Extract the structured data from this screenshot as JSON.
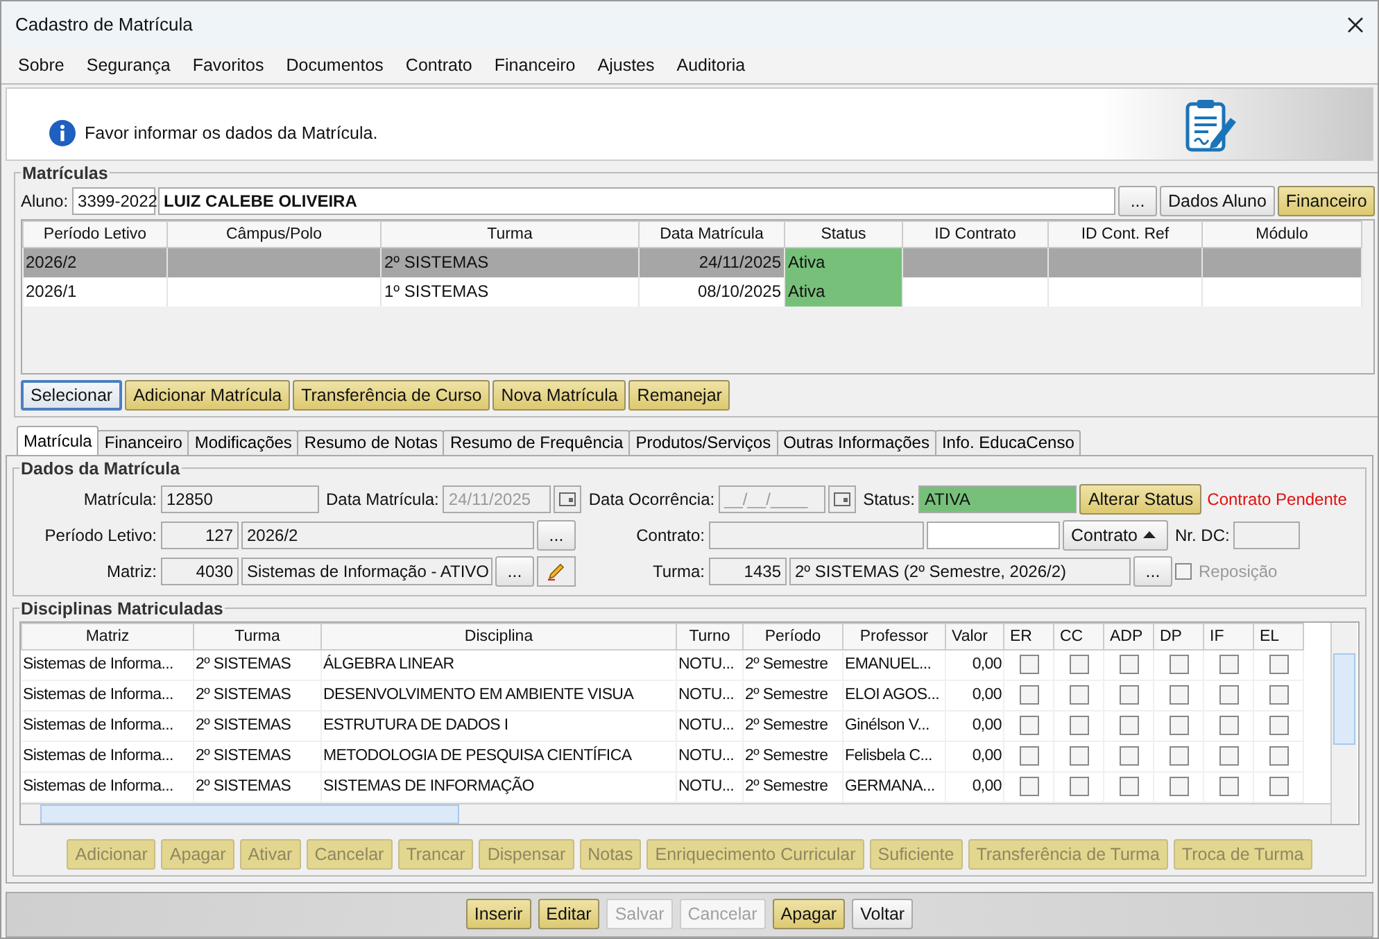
{
  "window": {
    "title": "Cadastro de Matrícula"
  },
  "menu": [
    "Sobre",
    "Segurança",
    "Favoritos",
    "Documentos",
    "Contrato",
    "Financeiro",
    "Ajustes",
    "Auditoria"
  ],
  "banner": {
    "message": "Favor informar os dados da Matrícula."
  },
  "matriculas": {
    "legend": "Matrículas",
    "aluno_label": "Aluno:",
    "aluno_code": "3399-2022",
    "aluno_name": "LUIZ CALEBE OLIVEIRA",
    "lookup": "...",
    "buttons": [
      {
        "label": "Dados Aluno",
        "kind": "plain"
      },
      {
        "label": "Financeiro",
        "kind": "yellow"
      }
    ],
    "columns": [
      "Período Letivo",
      "Câmpus/Polo",
      "Turma",
      "Data Matrícula",
      "Status",
      "ID Contrato",
      "ID Cont. Ref",
      "Módulo"
    ],
    "rows": [
      {
        "cells": [
          "2026/2",
          "",
          "2º SISTEMAS",
          "24/11/2025",
          "Ativa",
          "",
          "",
          ""
        ],
        "selected": true
      },
      {
        "cells": [
          "2026/1",
          "",
          "1º SISTEMAS",
          "08/10/2025",
          "Ativa",
          "",
          "",
          ""
        ],
        "selected": false
      }
    ],
    "actions": [
      {
        "label": "Selecionar",
        "kind": "focused"
      },
      {
        "label": "Adicionar Matrícula",
        "kind": "yellow"
      },
      {
        "label": "Transferência de Curso",
        "kind": "yellow"
      },
      {
        "label": "Nova Matrícula",
        "kind": "yellow"
      },
      {
        "label": "Remanejar",
        "kind": "yellow"
      }
    ]
  },
  "tabs": [
    {
      "label": "Matrícula",
      "selected": true
    },
    {
      "label": "Financeiro",
      "selected": false
    },
    {
      "label": "Modificações",
      "selected": false
    },
    {
      "label": "Resumo de Notas",
      "selected": false
    },
    {
      "label": "Resumo de Frequência",
      "selected": false
    },
    {
      "label": "Produtos/Serviços",
      "selected": false
    },
    {
      "label": "Outras Informações",
      "selected": false
    },
    {
      "label": "Info. EducaCenso",
      "selected": false
    }
  ],
  "dados": {
    "legend": "Dados da Matrícula",
    "matricula": {
      "label": "Matrícula:",
      "value": "12850"
    },
    "data_matricula": {
      "label": "Data Matrícula:",
      "value": "24/11/2025"
    },
    "data_ocorrencia": {
      "label": "Data Ocorrência:",
      "value": "__/__/____"
    },
    "status": {
      "label": "Status:",
      "value": "ATIVA",
      "button": "Alterar Status",
      "warning": "Contrato Pendente"
    },
    "periodo": {
      "label": "Período Letivo:",
      "code": "127",
      "value": "2026/2",
      "lookup": "..."
    },
    "contrato": {
      "label": "Contrato:",
      "button": "Contrato"
    },
    "nr_dc": {
      "label": "Nr. DC:"
    },
    "matriz": {
      "label": "Matriz:",
      "code": "4030",
      "value": "Sistemas de Informação - ATIVO",
      "lookup": "..."
    },
    "turma": {
      "label": "Turma:",
      "code": "1435",
      "value": "2º SISTEMAS (2º Semestre, 2026/2)",
      "lookup": "..."
    },
    "reposicao": {
      "label": "Reposição",
      "checked": false
    }
  },
  "disciplinas": {
    "legend": "Disciplinas Matriculadas",
    "columns": [
      "Matriz",
      "Turma",
      "Disciplina",
      "Turno",
      "Período",
      "Professor",
      "Valor",
      "ER",
      "CC",
      "ADP",
      "DP",
      "IF",
      "EL"
    ],
    "rows": [
      {
        "cells": [
          "Sistemas de Informa...",
          "2º SISTEMAS",
          "ÁLGEBRA LINEAR",
          "NOTU...",
          "2º Semestre",
          "EMANUEL...",
          "0,00"
        ],
        "checks": [
          false,
          false,
          false,
          false,
          false,
          false
        ]
      },
      {
        "cells": [
          "Sistemas de Informa...",
          "2º SISTEMAS",
          "DESENVOLVIMENTO EM AMBIENTE VISUA",
          "NOTU...",
          "2º Semestre",
          "ELOI AGOS...",
          "0,00"
        ],
        "checks": [
          false,
          false,
          false,
          false,
          false,
          false
        ]
      },
      {
        "cells": [
          "Sistemas de Informa...",
          "2º SISTEMAS",
          "ESTRUTURA DE DADOS I",
          "NOTU...",
          "2º Semestre",
          "Ginélson V...",
          "0,00"
        ],
        "checks": [
          false,
          false,
          false,
          false,
          false,
          false
        ]
      },
      {
        "cells": [
          "Sistemas de Informa...",
          "2º SISTEMAS",
          "METODOLOGIA DE PESQUISA CIENTÍFICA",
          "NOTU...",
          "2º Semestre",
          "Felisbela C...",
          "0,00"
        ],
        "checks": [
          false,
          false,
          false,
          false,
          false,
          false
        ]
      },
      {
        "cells": [
          "Sistemas de Informa...",
          "2º SISTEMAS",
          "SISTEMAS DE INFORMAÇÃO",
          "NOTU...",
          "2º Semestre",
          "GERMANA...",
          "0,00"
        ],
        "checks": [
          false,
          false,
          false,
          false,
          false,
          false
        ]
      }
    ],
    "actions": [
      {
        "label": "Adicionar",
        "disabled": true
      },
      {
        "label": "Apagar",
        "disabled": true
      },
      {
        "label": "Ativar",
        "disabled": true
      },
      {
        "label": "Cancelar",
        "disabled": true
      },
      {
        "label": "Trancar",
        "disabled": true
      },
      {
        "label": "Dispensar",
        "disabled": true
      },
      {
        "label": "Notas",
        "disabled": true
      },
      {
        "label": "Enriquecimento Curricular",
        "disabled": true
      },
      {
        "label": "Suficiente",
        "disabled": true
      },
      {
        "label": "Transferência de Turma",
        "disabled": true
      },
      {
        "label": "Troca de Turma",
        "disabled": true
      }
    ]
  },
  "footer_buttons": [
    {
      "label": "Inserir",
      "kind": "yellow"
    },
    {
      "label": "Editar",
      "kind": "yellow"
    },
    {
      "label": "Salvar",
      "kind": "disabled"
    },
    {
      "label": "Cancelar",
      "kind": "disabled"
    },
    {
      "label": "Apagar",
      "kind": "yellow"
    },
    {
      "label": "Voltar",
      "kind": "plain"
    }
  ]
}
